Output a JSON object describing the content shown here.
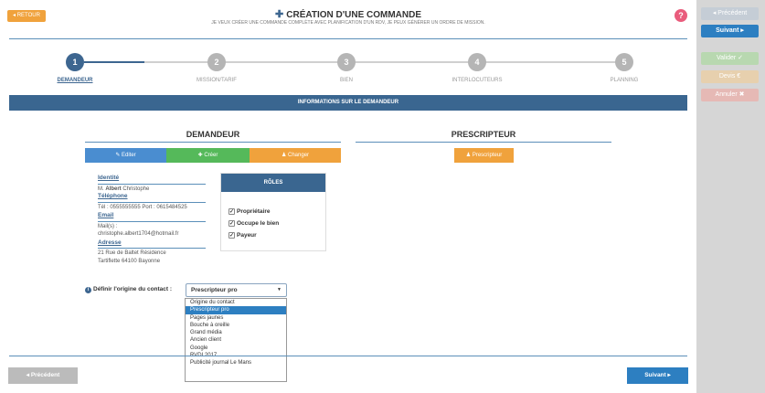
{
  "header": {
    "back_label": "◂ RETOUR",
    "title": "CRÉATION D'UNE COMMANDE",
    "subtitle": "JE VEUX CRÉER UNE COMMANDE COMPLÈTE AVEC PLANIFICATION D'UN RDV, JE PEUX GÉNÉRER UN ORDRE DE MISSION.",
    "help": "?"
  },
  "sidepanel": {
    "prev": "◂ Précédent",
    "next": "Suivant ▸",
    "validate": "Valider ✓",
    "devis": "Devis €",
    "cancel": "Annuler ✖"
  },
  "steps": [
    {
      "num": "1",
      "label": "DEMANDEUR"
    },
    {
      "num": "2",
      "label": "MISSION/TARIF"
    },
    {
      "num": "3",
      "label": "BIEN"
    },
    {
      "num": "4",
      "label": "INTERLOCUTEURS"
    },
    {
      "num": "5",
      "label": "PLANNING"
    }
  ],
  "info_bar": "INFORMATIONS SUR LE DEMANDEUR",
  "demandeur": {
    "heading": "DEMANDEUR",
    "edit": "✎ Editer",
    "create": "✚ Créer",
    "change": "♟ Changer",
    "identity_label": "Identité",
    "identity_prefix": "M.",
    "identity_last": "Albert",
    "identity_first": "Christophe",
    "phone_label": "Téléphone",
    "phone_value": "Tél : 0555555555  Port : 0615484525",
    "email_label": "Email",
    "email_prefix": "Mail(s) :",
    "email_value": "christophe.albert1704@hotmail.fr",
    "address_label": "Adresse",
    "address_line1": "21 Rue de Baltet Résidence",
    "address_line2": "Tartiflette 64100 Bayonne"
  },
  "roles": {
    "heading": "RÔLES",
    "items": [
      "Propriétaire",
      "Occupe le bien",
      "Payeur"
    ]
  },
  "prescripteur": {
    "heading": "PRESCRIPTEUR",
    "button": "♟ Prescripteur"
  },
  "origin": {
    "label": "Définir l'origine du contact :",
    "selected": "Prescripteur pro",
    "options": [
      "Origine du contact",
      "Prescripteur pro",
      "Pages jaunes",
      "Bouche à oreille",
      "Grand média",
      "Ancien client",
      "Google",
      "RVDI 2017",
      "Publicité journal Le Mans"
    ]
  },
  "footer": {
    "prev": "◂ Précédent",
    "next": "Suivant ▸"
  }
}
